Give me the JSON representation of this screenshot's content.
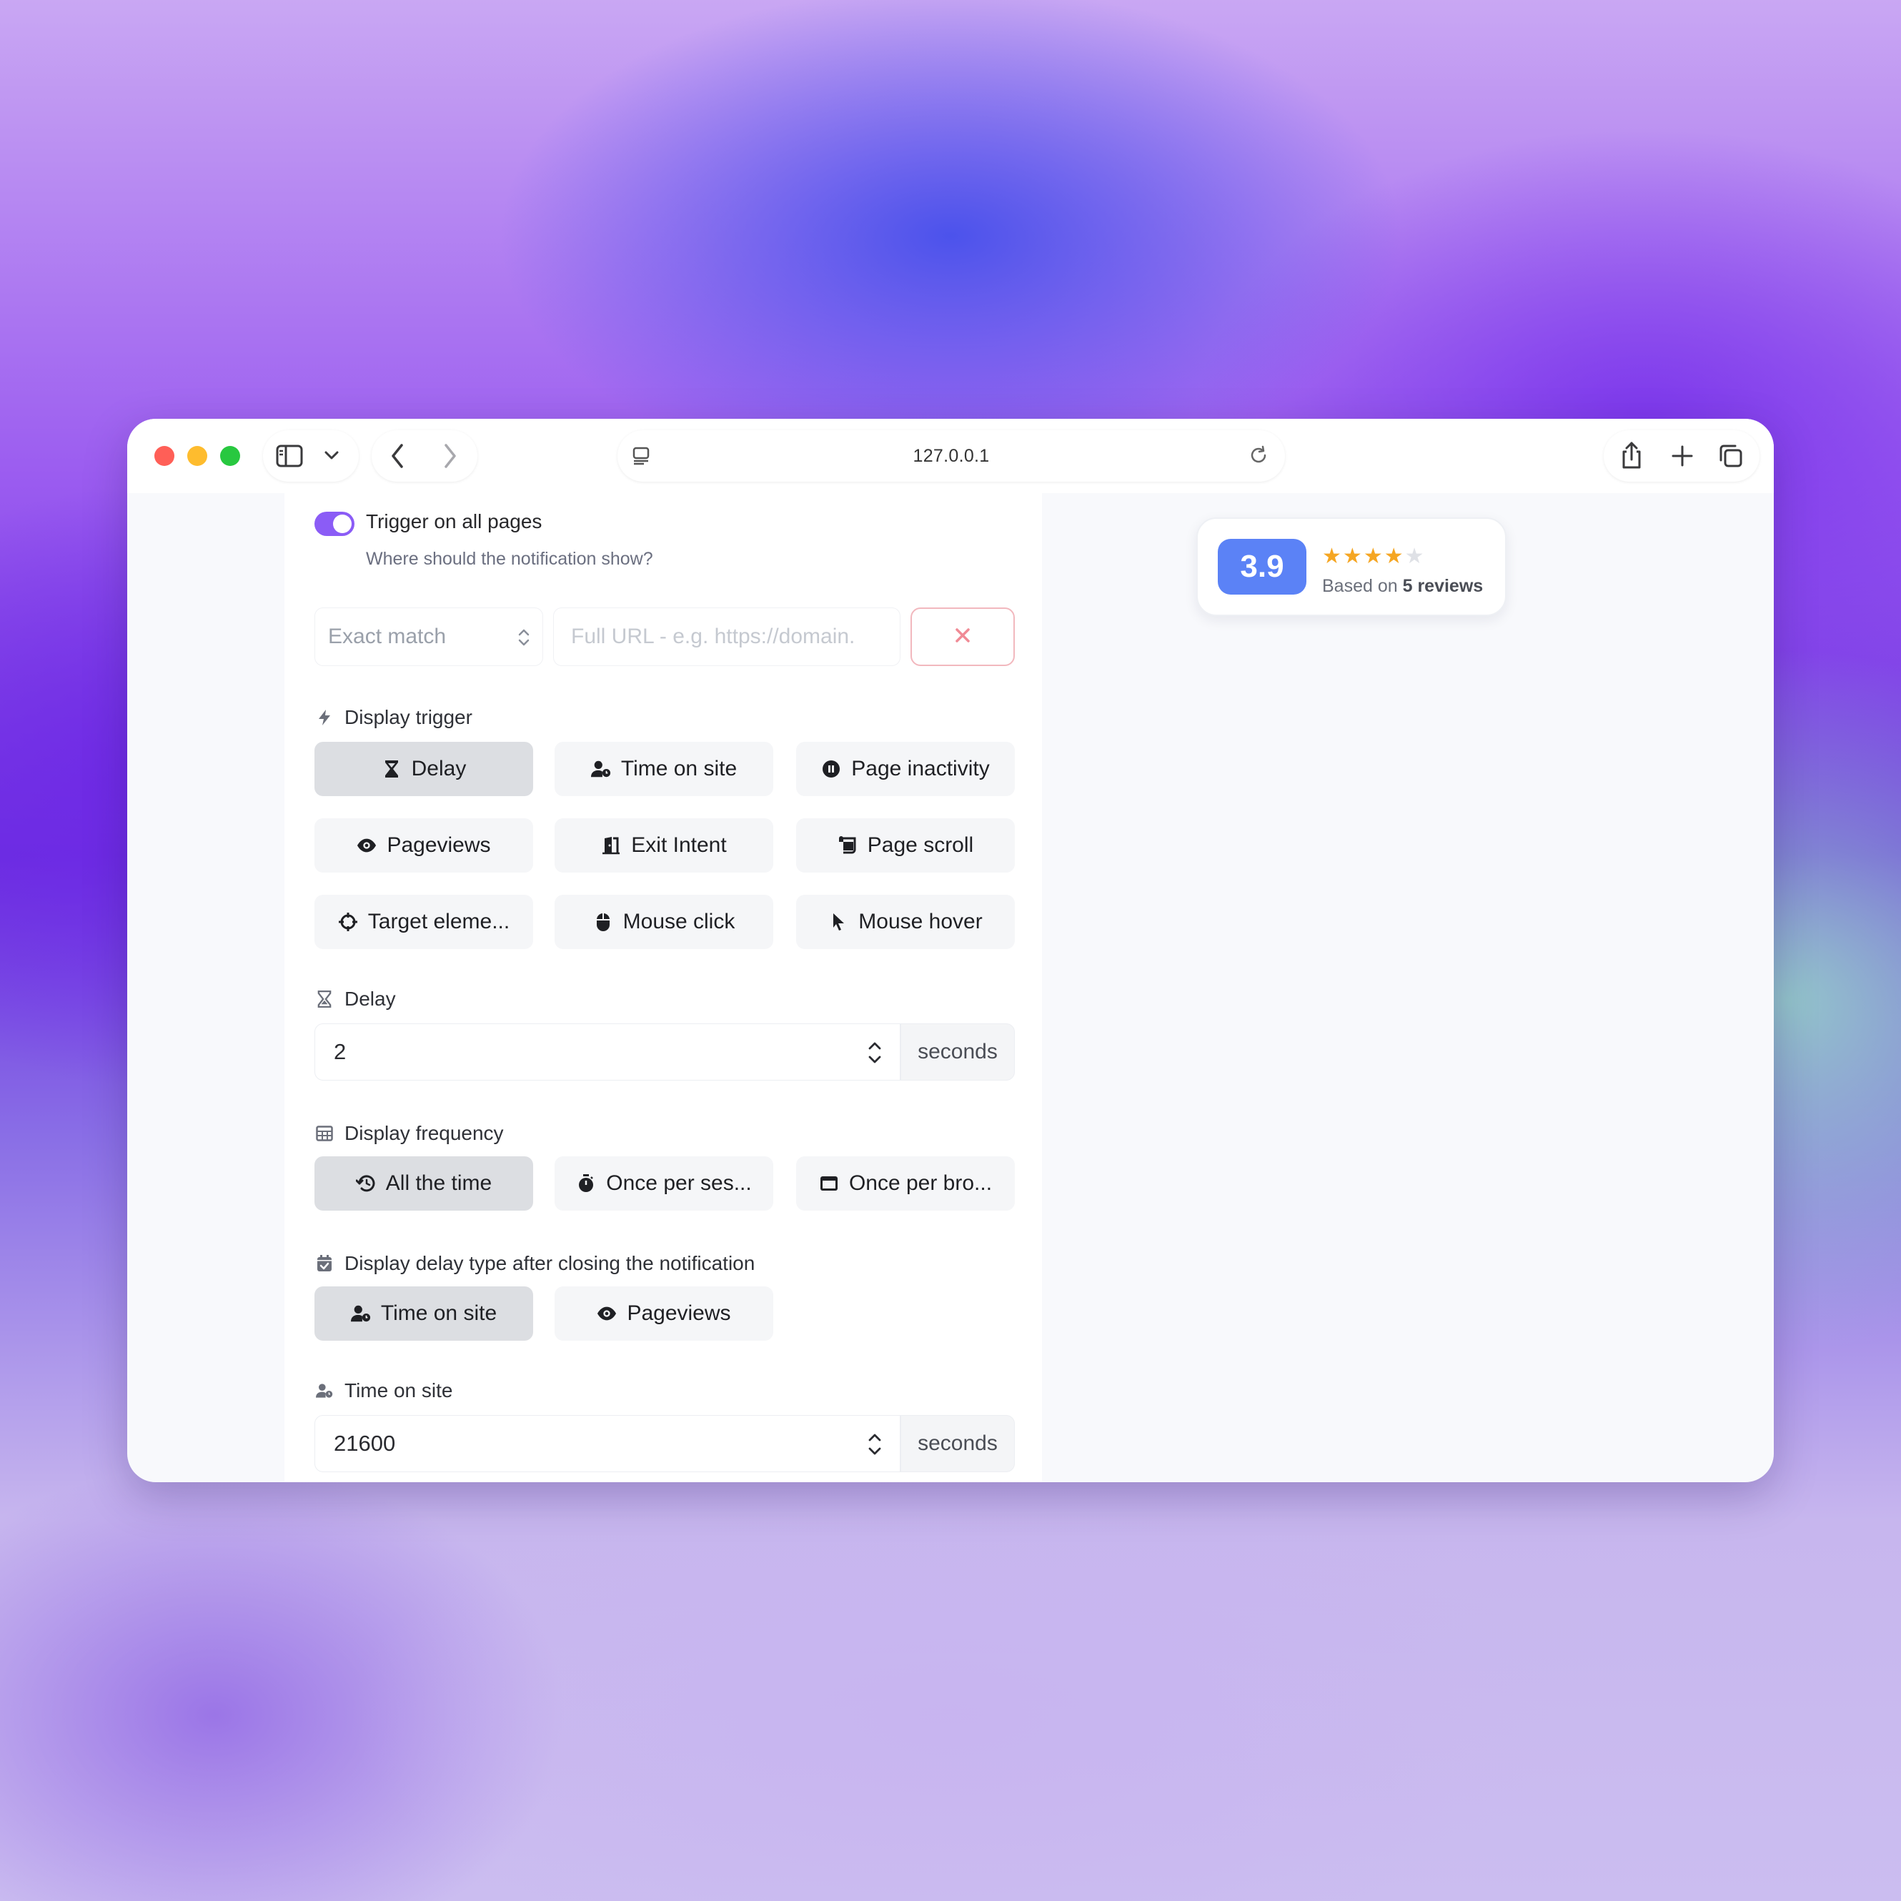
{
  "browser": {
    "url": "127.0.0.1"
  },
  "trigger_all_pages": {
    "label": "Trigger on all pages",
    "help": "Where should the notification show?",
    "enabled": true
  },
  "url_rule": {
    "match_type": "Exact match",
    "url_placeholder": "Full URL - e.g. https://domain.",
    "remove_label": "✕"
  },
  "display_trigger": {
    "label": "Display trigger",
    "options": [
      {
        "label": "Delay",
        "icon": "hourglass-icon",
        "active": true
      },
      {
        "label": "Time on site",
        "icon": "user-clock-icon",
        "active": false
      },
      {
        "label": "Page inactivity",
        "icon": "pause-circle-icon",
        "active": false
      },
      {
        "label": "Pageviews",
        "icon": "eye-icon",
        "active": false
      },
      {
        "label": "Exit Intent",
        "icon": "door-open-icon",
        "active": false
      },
      {
        "label": "Page scroll",
        "icon": "scroll-icon",
        "active": false
      },
      {
        "label": "Target eleme...",
        "icon": "crosshairs-icon",
        "active": false
      },
      {
        "label": "Mouse click",
        "icon": "mouse-icon",
        "active": false
      },
      {
        "label": "Mouse hover",
        "icon": "cursor-icon",
        "active": false
      }
    ]
  },
  "delay": {
    "label": "Delay",
    "value": "2",
    "unit": "seconds"
  },
  "display_frequency": {
    "label": "Display frequency",
    "options": [
      {
        "label": "All the time",
        "icon": "history-icon",
        "active": true
      },
      {
        "label": "Once per ses...",
        "icon": "stopwatch-icon",
        "active": false
      },
      {
        "label": "Once per bro...",
        "icon": "window-icon",
        "active": false
      }
    ]
  },
  "delay_type": {
    "label": "Display delay type after closing the notification",
    "options": [
      {
        "label": "Time on site",
        "icon": "user-clock-icon",
        "active": true
      },
      {
        "label": "Pageviews",
        "icon": "eye-icon",
        "active": false
      }
    ]
  },
  "time_on_site": {
    "label": "Time on site",
    "value": "21600",
    "unit": "seconds"
  },
  "rating": {
    "score": "3.9",
    "stars_filled": 4,
    "stars_total": 5,
    "based_prefix": "Based on ",
    "based_count": "5 reviews"
  },
  "colors": {
    "accent": "#8b5cf6",
    "score_bg": "#5b82f6",
    "star": "#f5a623",
    "remove_border": "#f2b8be",
    "remove_icon": "#f08a95"
  }
}
